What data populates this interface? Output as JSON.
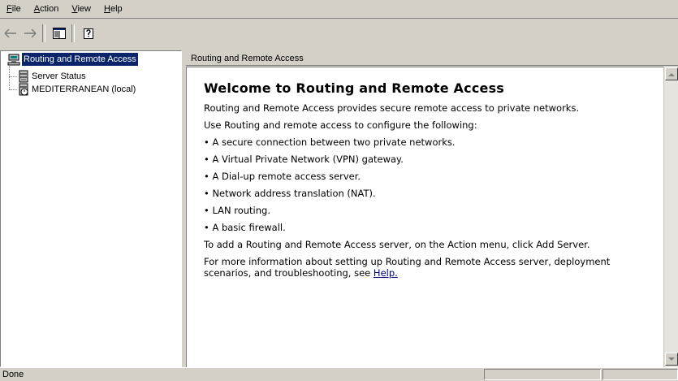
{
  "menu": {
    "items": [
      {
        "label": "File",
        "accel": "F",
        "rest": "ile"
      },
      {
        "label": "Action",
        "accel": "A",
        "rest": "ction"
      },
      {
        "label": "View",
        "accel": "V",
        "rest": "iew"
      },
      {
        "label": "Help",
        "accel": "H",
        "rest": "elp"
      }
    ]
  },
  "toolbar": {
    "back_icon": "back-arrow-icon",
    "forward_icon": "forward-arrow-icon",
    "show_hide_tree_icon": "console-tree-icon",
    "help_icon": "help-icon"
  },
  "tree": {
    "root": "Routing and Remote Access",
    "children": [
      "Server Status",
      "MEDITERRANEAN (local)"
    ]
  },
  "right_pane": {
    "header": "Routing and Remote Access",
    "title": "Welcome to Routing and Remote Access",
    "intro": "Routing and Remote Access provides secure remote access to private networks.",
    "use_line": "Use Routing and remote access to configure the following:",
    "bullets": [
      "• A secure connection between two private networks.",
      "• A Virtual Private Network (VPN) gateway.",
      "• A Dial-up remote access server.",
      "• Network address translation (NAT).",
      "• LAN routing.",
      "• A basic firewall."
    ],
    "add_server": "To add a Routing and Remote Access server, on the Action menu, click Add Server.",
    "more_info": "For more information about setting up Routing and Remote Access server, deployment scenarios, and troubleshooting, see ",
    "help_link": "Help."
  },
  "status": {
    "text": "Done"
  },
  "colors": {
    "chrome": "#d4d0c8",
    "selection": "#0a246a",
    "link": "#000080"
  }
}
